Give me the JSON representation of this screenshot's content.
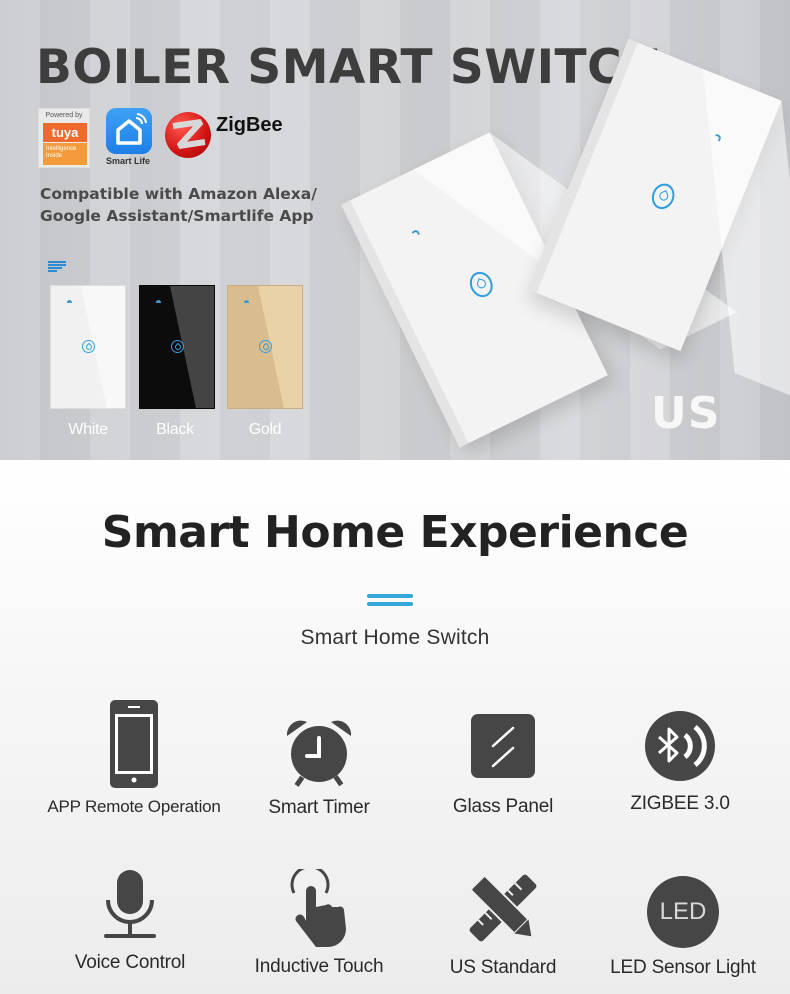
{
  "hero": {
    "title": "BOILER SMART SWITCH",
    "logos": {
      "tuya_powered_by": "Powered by",
      "tuya_brand": "tuya",
      "tuya_tagline": "Intelligence Inside",
      "smartlife_label": "Smart Life",
      "zigbee_label": "ZigBee"
    },
    "compatibility_text": "Compatible with Amazon Alexa/ Google Assistant/Smartlife App",
    "color_options": [
      {
        "label": "White",
        "color": "#f1f1f1"
      },
      {
        "label": "Black",
        "color": "#0c0c0c"
      },
      {
        "label": "Gold",
        "color": "#d9bd8e"
      }
    ],
    "region_label": "US"
  },
  "features_section": {
    "title": "Smart Home Experience",
    "subtitle": "Smart Home Switch",
    "accent_color": "#35a7d8",
    "icon_color": "#464646",
    "features": [
      {
        "icon": "smartphone-icon",
        "label": "APP Remote Operation"
      },
      {
        "icon": "alarm-clock-icon",
        "label": "Smart Timer"
      },
      {
        "icon": "glass-panel-icon",
        "label": "Glass Panel"
      },
      {
        "icon": "zigbee-wireless-icon",
        "label": "ZIGBEE 3.0"
      },
      {
        "icon": "microphone-icon",
        "label": "Voice Control"
      },
      {
        "icon": "touch-hand-icon",
        "label": "Inductive Touch"
      },
      {
        "icon": "ruler-pencil-icon",
        "label": "US  Standard"
      },
      {
        "icon": "led-icon",
        "label": "LED Sensor Light",
        "icon_text": "LED"
      }
    ]
  }
}
